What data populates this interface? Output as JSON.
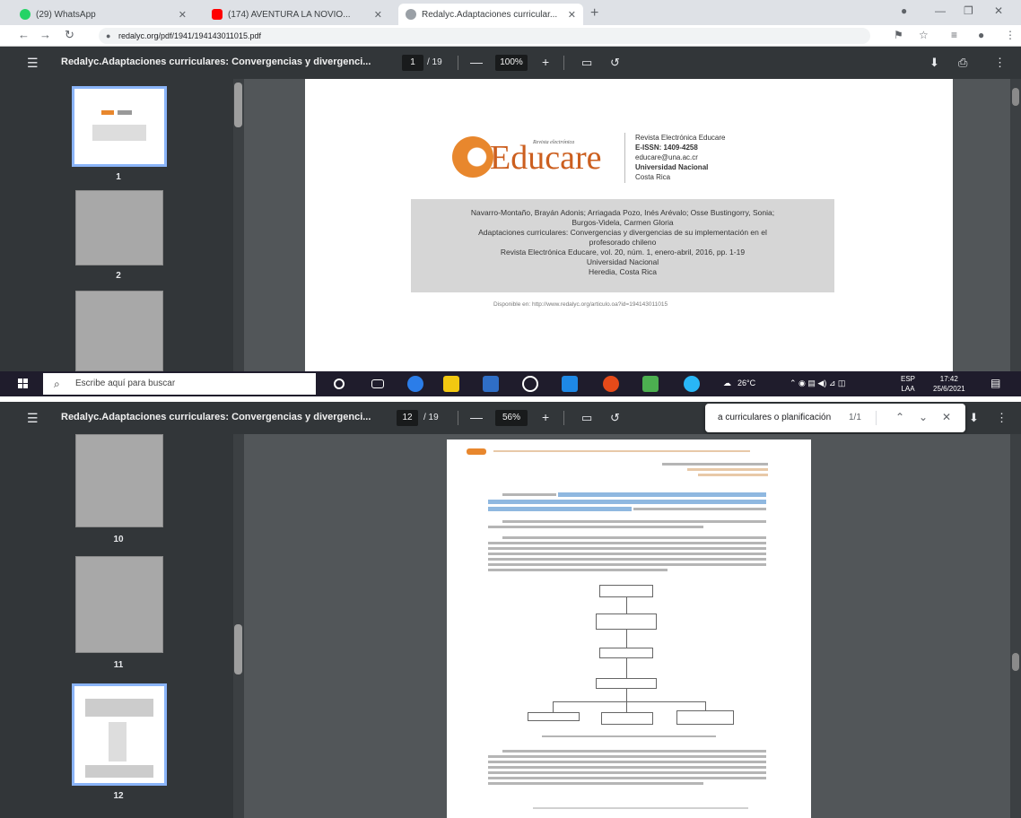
{
  "browser": {
    "tabs": [
      {
        "label": "(29) WhatsApp",
        "icon": "whatsapp-icon",
        "color": "#25d366"
      },
      {
        "label": "(174) AVENTURA LA NOVIO...",
        "icon": "youtube-icon",
        "color": "#ff0000"
      },
      {
        "label": "Redalyc.Adaptaciones curricular...",
        "icon": "redalyc-icon",
        "color": "#5f6368"
      }
    ],
    "new_tab": "+",
    "address": "redalyc.org/pdf/1941/194143011015.pdf"
  },
  "pdf_top": {
    "title": "Redalyc.Adaptaciones curriculares: Convergencias y divergenci...",
    "page_current": "1",
    "page_total": "/ 19",
    "zoom": "100%",
    "thumb_numbers": [
      "1",
      "2"
    ],
    "selected_page": 1
  },
  "page1": {
    "logo_small": "Revista electrónica",
    "logo_text": "Educare",
    "journal": {
      "name": "Revista Electrónica Educare",
      "issn": "E-ISSN: 1409-4258",
      "email": "educare@una.ac.cr",
      "university": "Universidad Nacional",
      "country": "Costa Rica"
    },
    "citation": [
      "Navarro-Montaño, Brayán Adonis; Arriagada Pozo, Inés Arévalo; Osse Bustingorry, Sonia;",
      "Burgos-Videla, Carmen Gloria",
      "Adaptaciones curriculares: Convergencias y divergencias de su implementación en el",
      "profesorado chileno",
      "Revista Electrónica Educare, vol. 20, núm. 1, enero-abril, 2016, pp. 1-19",
      "Universidad Nacional",
      "Heredia, Costa Rica"
    ],
    "available": "Disponible en: http://www.redalyc.org/articulo.oa?id=194143011015"
  },
  "taskbar": {
    "search_placeholder": "Escribe aquí para buscar",
    "weather": "26°C",
    "lang_1": "ESP",
    "lang_2": "LAA",
    "time": "17:42",
    "date": "25/6/2021"
  },
  "pdf_bottom": {
    "title": "Redalyc.Adaptaciones curriculares: Convergencias y divergenci...",
    "page_current": "12",
    "page_total": "/ 19",
    "zoom": "56%",
    "thumb_numbers": [
      "10",
      "11",
      "12"
    ],
    "selected_page": 12,
    "find": {
      "query": "a curriculares o planificación",
      "count": "1/1"
    }
  }
}
